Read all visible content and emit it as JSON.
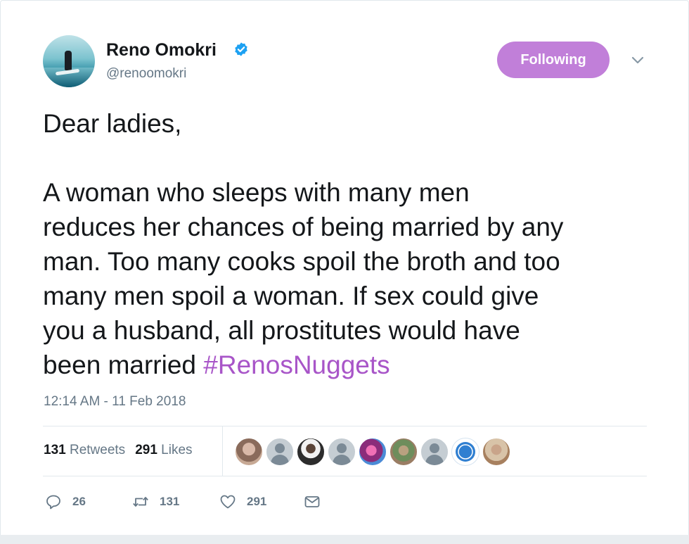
{
  "user": {
    "name": "Reno Omokri",
    "handle": "@renoomokri",
    "verified": true
  },
  "follow_button": {
    "label": "Following",
    "color": "#c17fd9"
  },
  "tweet": {
    "lines": [
      "Dear ladies,",
      "",
      "A woman who sleeps with many men",
      "reduces her chances of being married by any",
      "man. Too many cooks spoil the broth and too",
      "many men spoil a woman. If sex could give",
      "you a husband, all prostitutes would have",
      "been married "
    ],
    "hashtag": "#RenosNuggets",
    "hashtag_color": "#a855c8",
    "timestamp": "12:14 AM - 11 Feb 2018"
  },
  "stats": {
    "retweets_count": "131",
    "retweets_label": "Retweets",
    "likes_count": "291",
    "likes_label": "Likes"
  },
  "likers": [
    "liker-photo-1",
    "liker-default",
    "liker-photo-2",
    "liker-default",
    "liker-photo-3",
    "liker-photo-4",
    "liker-default",
    "liker-seo-logo",
    "liker-photo-5"
  ],
  "actions": {
    "reply_count": "26",
    "retweet_count": "131",
    "like_count": "291",
    "icons": [
      "reply-icon",
      "retweet-icon",
      "heart-icon",
      "envelope-icon"
    ]
  }
}
